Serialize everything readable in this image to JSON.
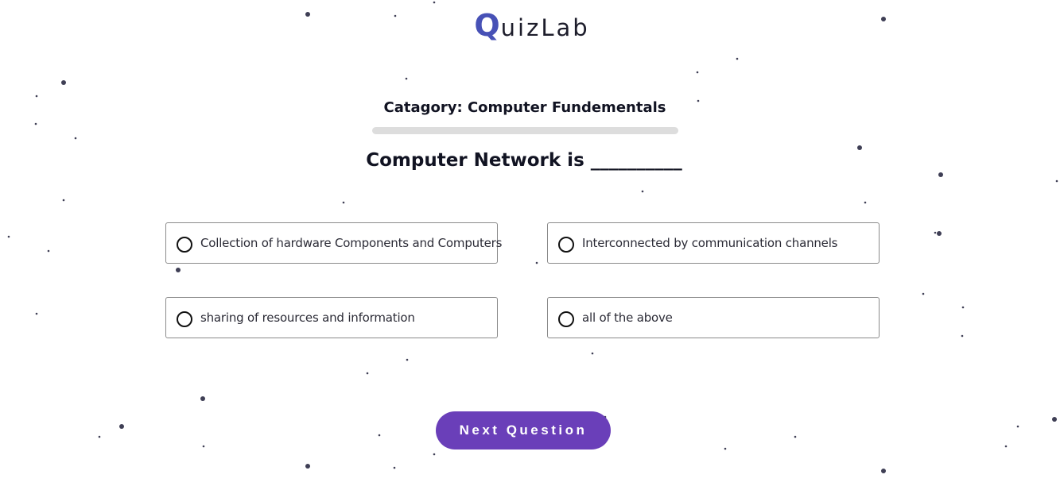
{
  "brand": {
    "initial": "Q",
    "rest": "uizLab",
    "accent": "#4751b6"
  },
  "category_label": "Catagory: Computer Fundementals",
  "progress": {
    "fraction": 0
  },
  "question": "Computer Network is __________",
  "options": [
    {
      "label": "Collection of hardware Components and Computers"
    },
    {
      "label": "Interconnected by communication channels"
    },
    {
      "label": "sharing of resources and information"
    },
    {
      "label": "all of the above"
    }
  ],
  "next_button": {
    "label": "Next Question",
    "color": "#6a3fb9"
  }
}
